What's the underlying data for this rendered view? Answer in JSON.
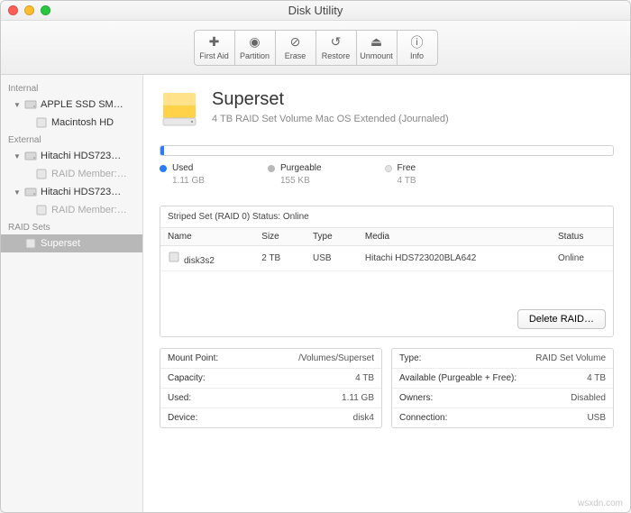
{
  "window": {
    "title": "Disk Utility"
  },
  "toolbar": [
    {
      "id": "firstaid",
      "label": "First Aid",
      "icon": "✚"
    },
    {
      "id": "partition",
      "label": "Partition",
      "icon": "◉"
    },
    {
      "id": "erase",
      "label": "Erase",
      "icon": "⊘"
    },
    {
      "id": "restore",
      "label": "Restore",
      "icon": "↺"
    },
    {
      "id": "unmount",
      "label": "Unmount",
      "icon": "⏏"
    },
    {
      "id": "info",
      "label": "Info",
      "icon": "ⓘ"
    }
  ],
  "sidebar": {
    "sections": [
      {
        "label": "Internal",
        "items": [
          {
            "label": "APPLE SSD SM…",
            "expand": true,
            "icon": "disk",
            "children": [
              {
                "label": "Macintosh HD",
                "icon": "vol"
              }
            ]
          }
        ]
      },
      {
        "label": "External",
        "items": [
          {
            "label": "Hitachi HDS723…",
            "expand": true,
            "icon": "disk",
            "children": [
              {
                "label": "RAID Member:…",
                "icon": "vol",
                "dim": true
              }
            ]
          },
          {
            "label": "Hitachi HDS723…",
            "expand": true,
            "icon": "disk",
            "children": [
              {
                "label": "RAID Member:…",
                "icon": "vol",
                "dim": true
              }
            ]
          }
        ]
      },
      {
        "label": "RAID Sets",
        "items": [
          {
            "label": "Superset",
            "icon": "vol",
            "selected": true
          }
        ]
      }
    ]
  },
  "volume": {
    "name": "Superset",
    "subtitle": "4 TB RAID Set Volume Mac OS Extended (Journaled)"
  },
  "usage": {
    "used": {
      "label": "Used",
      "value": "1.11 GB"
    },
    "purge": {
      "label": "Purgeable",
      "value": "155 KB"
    },
    "free": {
      "label": "Free",
      "value": "4 TB"
    }
  },
  "raid": {
    "title": "Striped Set (RAID 0) Status: Online",
    "headers": {
      "name": "Name",
      "size": "Size",
      "type": "Type",
      "media": "Media",
      "status": "Status"
    },
    "rows": [
      {
        "name": "disk3s2",
        "size": "2 TB",
        "type": "USB",
        "media": "Hitachi HDS723020BLA642",
        "status": "Online"
      }
    ],
    "delete_label": "Delete RAID…"
  },
  "info_left": [
    {
      "k": "Mount Point:",
      "v": "/Volumes/Superset"
    },
    {
      "k": "Capacity:",
      "v": "4 TB"
    },
    {
      "k": "Used:",
      "v": "1.11 GB"
    },
    {
      "k": "Device:",
      "v": "disk4"
    }
  ],
  "info_right": [
    {
      "k": "Type:",
      "v": "RAID Set Volume"
    },
    {
      "k": "Available (Purgeable + Free):",
      "v": "4 TB"
    },
    {
      "k": "Owners:",
      "v": "Disabled"
    },
    {
      "k": "Connection:",
      "v": "USB"
    }
  ],
  "watermark": "wsxdn.com"
}
